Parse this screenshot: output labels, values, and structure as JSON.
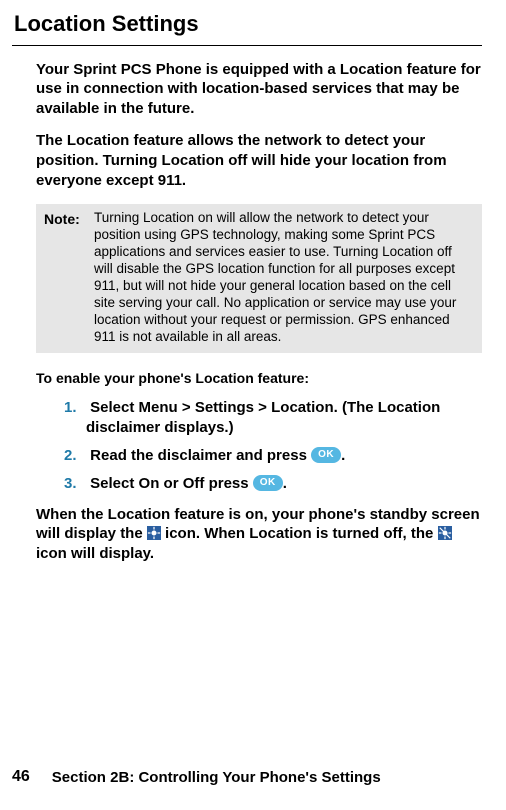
{
  "title": "Location Settings",
  "paragraphs": {
    "p1": "Your Sprint PCS Phone is equipped with a Location feature for use in connection with location-based services that may be available in the future.",
    "p2": "The Location feature allows the network to detect your position. Turning Location off will hide your location from everyone except 911."
  },
  "note": {
    "label": "Note:",
    "text": "Turning Location on will allow the network to detect your position using GPS technology, making some Sprint PCS applications and services easier to use. Turning Location off will disable the GPS location function for all purposes except 911, but will not hide your general location based on the cell site serving your call. No application or service may use your location without your request or permission. GPS enhanced 911 is not available in all areas."
  },
  "subhead": "To enable your phone's Location feature:",
  "steps": {
    "s1": {
      "num": "1.",
      "pre": "Select ",
      "b1": "Menu",
      "gt1": " > ",
      "b2": "Settings",
      "gt2": " > ",
      "b3": "Location",
      "post": ". (The Location",
      "cont": "disclaimer displays.)"
    },
    "s2": {
      "num": "2.",
      "text": "Read the disclaimer and press ",
      "dot": "."
    },
    "s3": {
      "num": "3.",
      "pre": "Select ",
      "b1": "On",
      "mid": " or ",
      "b2": "Off",
      "post": " press ",
      "dot": "."
    }
  },
  "ok_label": "OK",
  "closing": {
    "a": "When the Location feature is on, your phone's standby screen will display the ",
    "b": " icon. When Location is turned off, the ",
    "c": " icon will display."
  },
  "footer": {
    "page": "46",
    "text": "Section 2B: Controlling Your Phone's Settings"
  }
}
